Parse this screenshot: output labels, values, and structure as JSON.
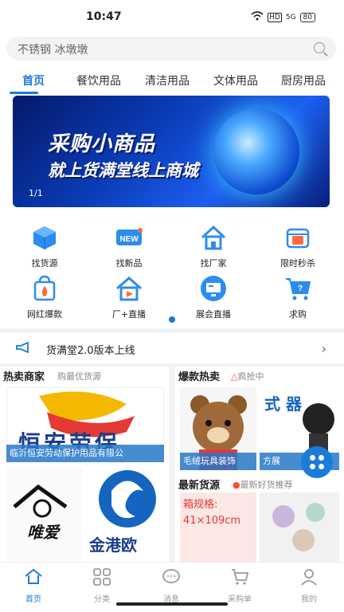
{
  "status": {
    "time": "10:47",
    "hd": "HD",
    "network": "5G",
    "battery": "80"
  },
  "search": {
    "placeholder": "不锈钢 冰墩墩"
  },
  "tabs": [
    {
      "label": "首页"
    },
    {
      "label": "餐饮用品"
    },
    {
      "label": "清洁用品"
    },
    {
      "label": "文体用品"
    },
    {
      "label": "厨房用品"
    }
  ],
  "banner": {
    "line1": "采购小商品",
    "line2": "就上货满堂线上商城",
    "page": "1/1"
  },
  "grid": [
    {
      "label": "找货源",
      "icon": "cube-icon"
    },
    {
      "label": "找新品",
      "icon": "new-badge-icon"
    },
    {
      "label": "找厂家",
      "icon": "house-icon"
    },
    {
      "label": "限时秒杀",
      "icon": "flash-sale-icon"
    },
    {
      "label": "网红爆款",
      "icon": "hot-bag-icon"
    },
    {
      "label": "厂+直播",
      "icon": "live-house-icon"
    },
    {
      "label": "展会直播",
      "icon": "monitor-icon"
    },
    {
      "label": "求购",
      "icon": "cart-question-icon"
    }
  ],
  "notice": {
    "text": "货满堂2.0版本上线"
  },
  "hot_merchants": {
    "title": "热卖商家",
    "subtitle": "购最优货源",
    "card1_caption": "临沂恒安劳动保护用品有限公",
    "card1_logo_text": "恒安劳保",
    "card2_logo_text": "唯爱",
    "card3_logo_text": "金港欧"
  },
  "hot_products": {
    "title": "爆款热卖",
    "subtitle": "疯抢中",
    "item1_caption": "毛绒玩具装饰",
    "item2_caption": "方展",
    "item2_text": "式 器"
  },
  "new_products": {
    "title": "最新货源",
    "subtitle": "最新好货推荐",
    "item1_text": "箱规格: 41×109cm"
  },
  "bottom_nav": [
    {
      "label": "首页"
    },
    {
      "label": "分类"
    },
    {
      "label": "消息"
    },
    {
      "label": "采购单"
    },
    {
      "label": "我的"
    }
  ],
  "colors": {
    "accent": "#1a7bd8",
    "hot": "#ff4d2e"
  }
}
